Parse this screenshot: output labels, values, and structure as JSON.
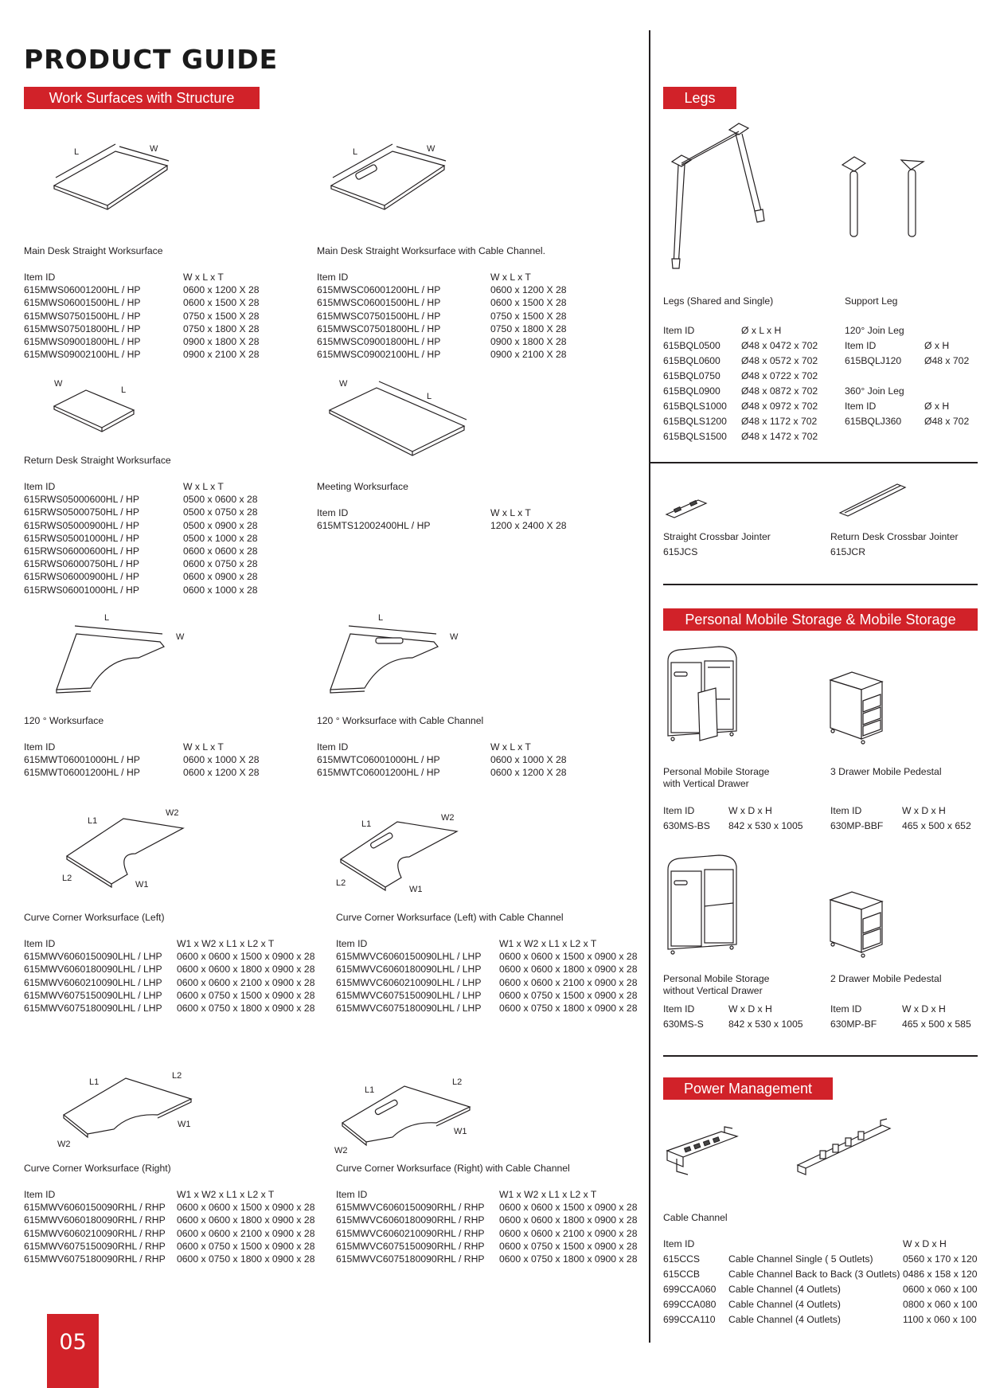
{
  "page": {
    "title": "PRODUCT GUIDE",
    "page_number": "05",
    "accent_color": "#d12229"
  },
  "work_surfaces": {
    "banner": "Work Surfaces with Structure",
    "dim_labels": {
      "L": "L",
      "W": "W",
      "L1": "L1",
      "L2": "L2",
      "W1": "W1",
      "W2": "W2"
    },
    "main_straight": {
      "name": "Main Desk Straight Worksurface",
      "headers": [
        "Item ID",
        "W x L x T"
      ],
      "rows": [
        [
          "615MWS06001200HL / HP",
          "0600 x 1200 X 28"
        ],
        [
          "615MWS06001500HL / HP",
          "0600 x 1500 X 28"
        ],
        [
          "615MWS07501500HL / HP",
          "0750 x 1500 X 28"
        ],
        [
          "615MWS07501800HL / HP",
          "0750 x 1800 X 28"
        ],
        [
          "615MWS09001800HL / HP",
          "0900 x 1800 X 28"
        ],
        [
          "615MWS09002100HL / HP",
          "0900 x 2100 X 28"
        ]
      ]
    },
    "main_straight_cable": {
      "name": "Main Desk Straight Worksurface with Cable Channel.",
      "headers": [
        "Item ID",
        "W x L x T"
      ],
      "rows": [
        [
          "615MWSC06001200HL / HP",
          "0600 x 1200 X 28"
        ],
        [
          "615MWSC06001500HL / HP",
          "0600 x 1500 X 28"
        ],
        [
          "615MWSC07501500HL / HP",
          "0750 x 1500 X 28"
        ],
        [
          "615MWSC07501800HL / HP",
          "0750 x 1800 X 28"
        ],
        [
          "615MWSC09001800HL / HP",
          "0900 x 1800 X 28"
        ],
        [
          "615MWSC09002100HL / HP",
          "0900 x 2100 X 28"
        ]
      ]
    },
    "return_straight": {
      "name": "Return Desk Straight Worksurface",
      "headers": [
        "Item ID",
        "W x L x T"
      ],
      "rows": [
        [
          "615RWS05000600HL / HP",
          "0500 x 0600 x 28"
        ],
        [
          "615RWS05000750HL / HP",
          "0500 x 0750 x 28"
        ],
        [
          "615RWS05000900HL / HP",
          "0500 x 0900 x 28"
        ],
        [
          "615RWS05001000HL / HP",
          "0500 x 1000 x 28"
        ],
        [
          "615RWS06000600HL / HP",
          "0600 x 0600 x 28"
        ],
        [
          "615RWS06000750HL / HP",
          "0600 x 0750 x 28"
        ],
        [
          "615RWS06000900HL / HP",
          "0600 x 0900 x 28"
        ],
        [
          "615RWS06001000HL / HP",
          "0600 x 1000 x 28"
        ]
      ]
    },
    "meeting": {
      "name": "Meeting Worksurface",
      "headers": [
        "Item ID",
        "W x L x T"
      ],
      "rows": [
        [
          "615MTS12002400HL / HP",
          "1200 x 2400 X 28"
        ]
      ]
    },
    "w120": {
      "name": "120 ° Worksurface",
      "headers": [
        "Item ID",
        "W x L x T"
      ],
      "rows": [
        [
          "615MWT06001000HL / HP",
          "0600 x 1000 X 28"
        ],
        [
          "615MWT06001200HL / HP",
          "0600 x 1200 X 28"
        ]
      ]
    },
    "w120_cable": {
      "name": "120 ° Worksurface with Cable Channel",
      "headers": [
        "Item ID",
        "W x L x T"
      ],
      "rows": [
        [
          "615MWTC06001000HL / HP",
          "0600 x 1000 X 28"
        ],
        [
          "615MWTC06001200HL / HP",
          "0600 x 1200 X 28"
        ]
      ]
    },
    "curve_left": {
      "name": "Curve Corner Worksurface (Left)",
      "headers": [
        "Item ID",
        "W1 x W2 x L1 x L2 x T"
      ],
      "rows": [
        [
          "615MWV6060150090LHL / LHP",
          "0600 x 0600 x 1500 x 0900 x 28"
        ],
        [
          "615MWV6060180090LHL / LHP",
          "0600 x 0600 x 1800 x 0900 x 28"
        ],
        [
          "615MWV6060210090LHL / LHP",
          "0600 x 0600 x 2100 x 0900 x 28"
        ],
        [
          "615MWV6075150090LHL / LHP",
          "0600 x 0750 x 1500 x 0900 x 28"
        ],
        [
          "615MWV6075180090LHL / LHP",
          "0600 x 0750 x 1800 x 0900 x 28"
        ]
      ]
    },
    "curve_left_cable": {
      "name": "Curve Corner Worksurface (Left) with Cable Channel",
      "headers": [
        "Item ID",
        "W1 x W2 x L1 x L2 x T"
      ],
      "rows": [
        [
          "615MWVC6060150090LHL / LHP",
          "0600 x 0600 x 1500 x 0900 x 28"
        ],
        [
          "615MWVC6060180090LHL / LHP",
          "0600 x 0600 x 1800 x 0900 x 28"
        ],
        [
          "615MWVC6060210090LHL / LHP",
          "0600 x 0600 x 2100 x 0900 x 28"
        ],
        [
          "615MWVC6075150090LHL / LHP",
          "0600 x 0750 x 1500 x 0900 x 28"
        ],
        [
          "615MWVC6075180090LHL / LHP",
          "0600 x 0750 x 1800 x 0900 x 28"
        ]
      ]
    },
    "curve_right": {
      "name": "Curve Corner Worksurface (Right)",
      "headers": [
        "Item ID",
        "W1 x W2 x L1 x L2 x T"
      ],
      "rows": [
        [
          "615MWV6060150090RHL / RHP",
          "0600 x 0600 x 1500 x 0900 x 28"
        ],
        [
          "615MWV6060180090RHL / RHP",
          "0600 x 0600 x 1800 x 0900 x 28"
        ],
        [
          "615MWV6060210090RHL / RHP",
          "0600 x 0600 x 2100 x 0900 x 28"
        ],
        [
          "615MWV6075150090RHL / RHP",
          "0600 x 0750 x 1500 x 0900 x 28"
        ],
        [
          "615MWV6075180090RHL / RHP",
          "0600 x 0750 x 1800 x 0900 x 28"
        ]
      ]
    },
    "curve_right_cable": {
      "name": "Curve Corner Worksurface (Right) with Cable Channel",
      "headers": [
        "Item ID",
        "W1 x W2 x L1 x L2 x T"
      ],
      "rows": [
        [
          "615MWVC6060150090RHL / RHP",
          "0600 x 0600 x 1500 x 0900 x 28"
        ],
        [
          "615MWVC6060180090RHL / RHP",
          "0600 x 0600 x 1800 x 0900 x 28"
        ],
        [
          "615MWVC6060210090RHL / RHP",
          "0600 x 0600 x 2100 x 0900 x 28"
        ],
        [
          "615MWVC6075150090RHL / RHP",
          "0600 x 0750 x 1500 x 0900 x 28"
        ],
        [
          "615MWVC6075180090RHL / RHP",
          "0600 x 0750 x 1800 x 0900 x 28"
        ]
      ]
    }
  },
  "legs": {
    "banner": "Legs",
    "shared": {
      "name": "Legs (Shared and Single)",
      "headers": [
        "Item ID",
        "Ø x L x H"
      ],
      "rows": [
        [
          "615BQL0500",
          "Ø48 x 0472 x 702"
        ],
        [
          "615BQL0600",
          "Ø48 x 0572 x 702"
        ],
        [
          "615BQL0750",
          "Ø48 x 0722 x 702"
        ],
        [
          "615BQL0900",
          "Ø48 x 0872 x 702"
        ],
        [
          "615BQLS1000",
          "Ø48 x 0972 x 702"
        ],
        [
          "615BQLS1200",
          "Ø48 x 1172 x 702"
        ],
        [
          "615BQLS1500",
          "Ø48 x 1472 x 702"
        ]
      ]
    },
    "support": {
      "name": "Support Leg",
      "join120": {
        "label": "120° Join Leg",
        "headers": [
          "Item ID",
          "Ø x H"
        ],
        "row": [
          "615BQLJ120",
          "Ø48 x 702"
        ]
      },
      "join360": {
        "label": "360° Join Leg",
        "headers": [
          "Item ID",
          "Ø x H"
        ],
        "row": [
          "615BQLJ360",
          "Ø48 x 702"
        ]
      }
    }
  },
  "crossbar": {
    "straight": {
      "name": "Straight Crossbar Jointer",
      "id": "615JCS"
    },
    "return": {
      "name": "Return Desk Crossbar Jointer",
      "id": "615JCR"
    }
  },
  "storage": {
    "banner": "Personal Mobile Storage & Mobile Storage",
    "items": [
      {
        "name": "Personal Mobile Storage\nwith Vertical Drawer",
        "headers": [
          "Item ID",
          "W x D x H"
        ],
        "row": [
          "630MS-BS",
          "842 x 530 x 1005"
        ]
      },
      {
        "name": "3 Drawer Mobile  Pedestal",
        "headers": [
          "Item ID",
          "W x D x H"
        ],
        "row": [
          "630MP-BBF",
          "465 x 500 x 652"
        ]
      },
      {
        "name": "Personal Mobile Storage\nwithout Vertical Drawer",
        "headers": [
          "Item ID",
          "W x D x H"
        ],
        "row": [
          "630MS-S",
          "842 x 530 x 1005"
        ]
      },
      {
        "name": "2 Drawer Mobile Pedestal",
        "headers": [
          "Item ID",
          "W x D x H"
        ],
        "row": [
          "630MP-BF",
          "465 x 500 x 585"
        ]
      }
    ]
  },
  "power": {
    "banner": "Power Management",
    "name": "Cable Channel",
    "headers": [
      "Item ID",
      "",
      "W x D x H"
    ],
    "rows": [
      [
        "615CCS",
        "Cable Channel Single ( 5 Outlets)",
        "0560 x 170 x 120"
      ],
      [
        "615CCB",
        "Cable Channel Back to Back (3 Outlets)",
        "0486 x 158 x 120"
      ],
      [
        "699CCA060",
        "Cable Channel (4 Outlets)",
        "0600 x 060 x 100"
      ],
      [
        "699CCA080",
        "Cable Channel (4 Outlets)",
        "0800 x 060 x 100"
      ],
      [
        "699CCA110",
        "Cable Channel (4 Outlets)",
        "1100 x 060 x 100"
      ]
    ]
  }
}
